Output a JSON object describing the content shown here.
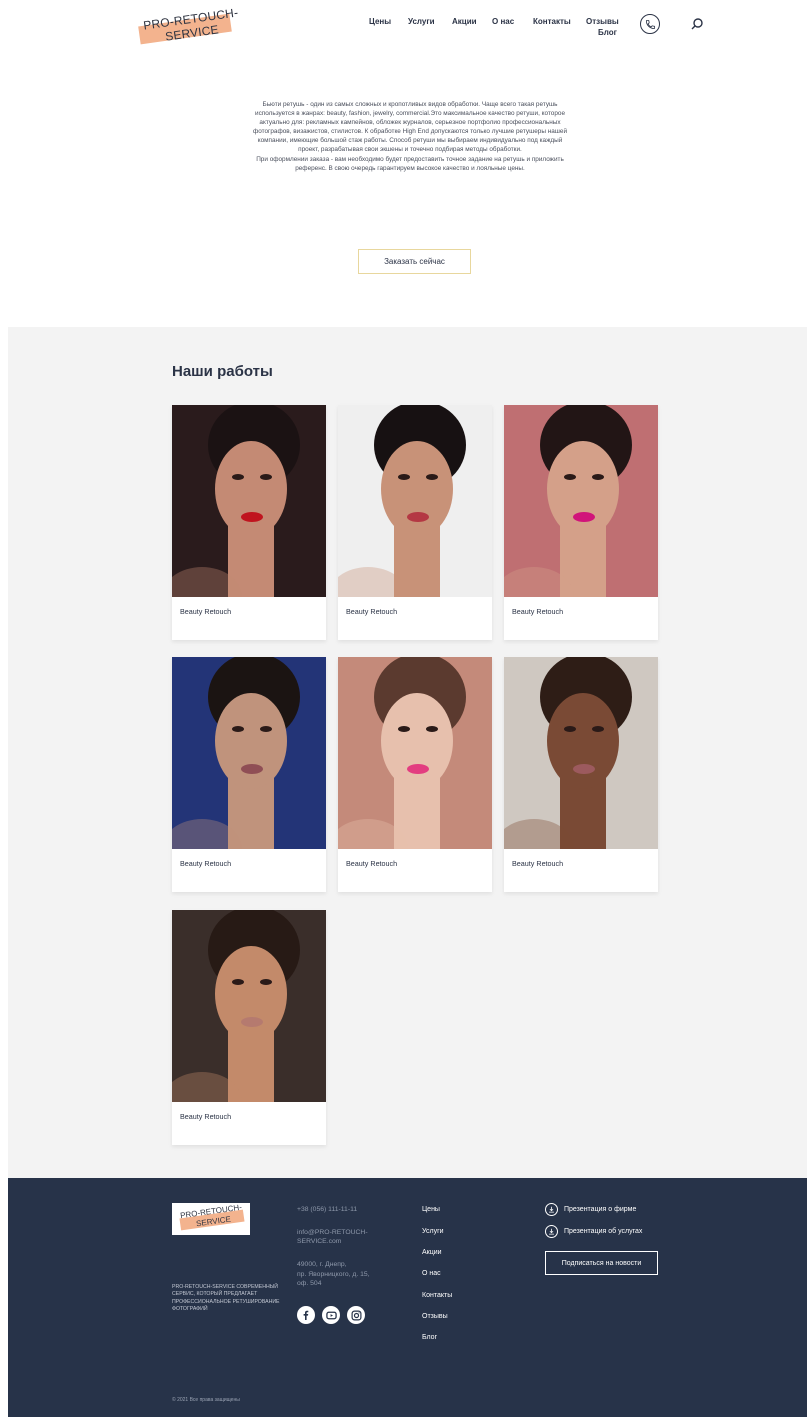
{
  "header": {
    "logo_line1": "PRO-RETOUCH-",
    "logo_line2": "SERVICE",
    "nav": [
      "Цены",
      "Услуги",
      "Акции",
      "О нас",
      "Контакты",
      "Отзывы",
      "Блог"
    ],
    "phone_icon": "phone-icon",
    "search_icon": "search-icon"
  },
  "intro": {
    "paragraph1": "Бьюти ретушь - один из самых сложных и кропотливых видов обработки. Чаще всего такая ретушь используется в жанрах: beauty, fashion, jewelry, commercial.Это максимальное качество ретуши, которое актуально для: рекламных кампейнов, обложек журналов, серьезное портфолио профессиональных фотографов, визажистов, стилистов. К обработке High End допускаются только лучшие ретушеры нашей компании, имеющие большой стаж работы. Способ ретуши мы выбираем индивидуально под каждый проект, разрабатывая свои экшены и точечно подбирая методы обработки.",
    "paragraph2": "При оформлении заказа - вам необходимо будет предоставить точное задание на ретушь и приложить референс. В свою очередь гарантируем высокое качество и лояльные цены.",
    "order_button": "Заказать сейчас"
  },
  "works": {
    "title": "Наши работы",
    "cards": [
      {
        "label": "Beauty Retouch",
        "bg": "#2a1b1c",
        "skin": "#c48a74",
        "hair": "#1b1213",
        "accent": "#c0141e"
      },
      {
        "label": "Beauty Retouch",
        "bg": "#efefef",
        "skin": "#c89278",
        "hair": "#171112",
        "accent": "#b43843"
      },
      {
        "label": "Beauty Retouch",
        "bg": "#bf6f72",
        "skin": "#d4a089",
        "hair": "#221515",
        "accent": "#d1147a"
      },
      {
        "label": "Beauty Retouch",
        "bg": "#233477",
        "skin": "#c0937c",
        "hair": "#1b1412",
        "accent": "#8f4e55"
      },
      {
        "label": "Beauty Retouch",
        "bg": "#c48a7a",
        "skin": "#e7c0ad",
        "hair": "#5b3a2f",
        "accent": "#e33d80"
      },
      {
        "label": "Beauty Retouch",
        "bg": "#cfc8c1",
        "skin": "#7a4a35",
        "hair": "#2e1d16",
        "accent": "#9c5a5e"
      },
      {
        "label": "Beauty Retouch",
        "bg": "#3a2e2a",
        "skin": "#c38a6a",
        "hair": "#271a15",
        "accent": "#b57a6f"
      }
    ]
  },
  "footer": {
    "logo_line1": "PRO-RETOUCH-",
    "logo_line2": "SERVICE",
    "description": "PRO-RETOUCH-SERVICE современный сервис, который предлагает профессиональное ретуширование фотографий",
    "phone": "+38 (056) 111-11-11",
    "email_line1": "info@PRO-RETOUCH-",
    "email_line2": "SERVICE.com",
    "address_line1": "49000, г. Днепр,",
    "address_line2": "пр. Яворницкого, д. 15,",
    "address_line3": "оф. 504",
    "social_icons": [
      "facebook-icon",
      "youtube-icon",
      "instagram-icon"
    ],
    "links": [
      "Цены",
      "Услуги",
      "Акции",
      "О нас",
      "Контакты",
      "Отзывы",
      "Блог"
    ],
    "presentation_company": "Презентация о фирме",
    "presentation_services": "Презентация об услугах",
    "subscribe": "Подписаться на новости",
    "copyright": "© 2021 Все права защищены"
  },
  "colors": {
    "accent_orange": "#f3b38e",
    "footer_bg": "#273349",
    "section_bg": "#f3f3f3",
    "text_dark": "#2b3346"
  }
}
